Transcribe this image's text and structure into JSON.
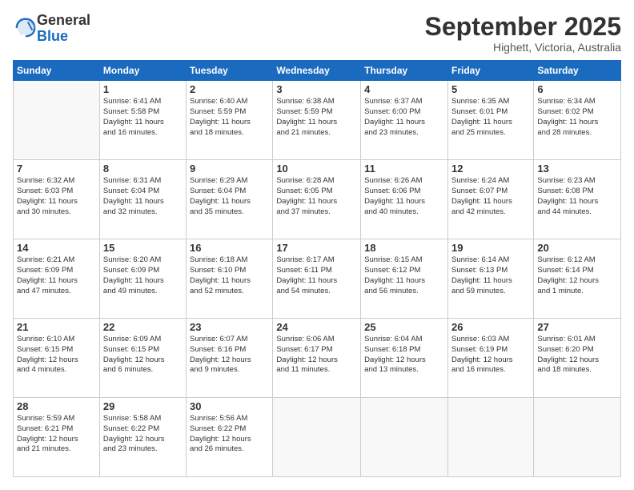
{
  "logo": {
    "general": "General",
    "blue": "Blue"
  },
  "header": {
    "month": "September 2025",
    "location": "Highett, Victoria, Australia"
  },
  "weekdays": [
    "Sunday",
    "Monday",
    "Tuesday",
    "Wednesday",
    "Thursday",
    "Friday",
    "Saturday"
  ],
  "weeks": [
    [
      {
        "day": "",
        "info": ""
      },
      {
        "day": "1",
        "info": "Sunrise: 6:41 AM\nSunset: 5:58 PM\nDaylight: 11 hours\nand 16 minutes."
      },
      {
        "day": "2",
        "info": "Sunrise: 6:40 AM\nSunset: 5:59 PM\nDaylight: 11 hours\nand 18 minutes."
      },
      {
        "day": "3",
        "info": "Sunrise: 6:38 AM\nSunset: 5:59 PM\nDaylight: 11 hours\nand 21 minutes."
      },
      {
        "day": "4",
        "info": "Sunrise: 6:37 AM\nSunset: 6:00 PM\nDaylight: 11 hours\nand 23 minutes."
      },
      {
        "day": "5",
        "info": "Sunrise: 6:35 AM\nSunset: 6:01 PM\nDaylight: 11 hours\nand 25 minutes."
      },
      {
        "day": "6",
        "info": "Sunrise: 6:34 AM\nSunset: 6:02 PM\nDaylight: 11 hours\nand 28 minutes."
      }
    ],
    [
      {
        "day": "7",
        "info": "Sunrise: 6:32 AM\nSunset: 6:03 PM\nDaylight: 11 hours\nand 30 minutes."
      },
      {
        "day": "8",
        "info": "Sunrise: 6:31 AM\nSunset: 6:04 PM\nDaylight: 11 hours\nand 32 minutes."
      },
      {
        "day": "9",
        "info": "Sunrise: 6:29 AM\nSunset: 6:04 PM\nDaylight: 11 hours\nand 35 minutes."
      },
      {
        "day": "10",
        "info": "Sunrise: 6:28 AM\nSunset: 6:05 PM\nDaylight: 11 hours\nand 37 minutes."
      },
      {
        "day": "11",
        "info": "Sunrise: 6:26 AM\nSunset: 6:06 PM\nDaylight: 11 hours\nand 40 minutes."
      },
      {
        "day": "12",
        "info": "Sunrise: 6:24 AM\nSunset: 6:07 PM\nDaylight: 11 hours\nand 42 minutes."
      },
      {
        "day": "13",
        "info": "Sunrise: 6:23 AM\nSunset: 6:08 PM\nDaylight: 11 hours\nand 44 minutes."
      }
    ],
    [
      {
        "day": "14",
        "info": "Sunrise: 6:21 AM\nSunset: 6:09 PM\nDaylight: 11 hours\nand 47 minutes."
      },
      {
        "day": "15",
        "info": "Sunrise: 6:20 AM\nSunset: 6:09 PM\nDaylight: 11 hours\nand 49 minutes."
      },
      {
        "day": "16",
        "info": "Sunrise: 6:18 AM\nSunset: 6:10 PM\nDaylight: 11 hours\nand 52 minutes."
      },
      {
        "day": "17",
        "info": "Sunrise: 6:17 AM\nSunset: 6:11 PM\nDaylight: 11 hours\nand 54 minutes."
      },
      {
        "day": "18",
        "info": "Sunrise: 6:15 AM\nSunset: 6:12 PM\nDaylight: 11 hours\nand 56 minutes."
      },
      {
        "day": "19",
        "info": "Sunrise: 6:14 AM\nSunset: 6:13 PM\nDaylight: 11 hours\nand 59 minutes."
      },
      {
        "day": "20",
        "info": "Sunrise: 6:12 AM\nSunset: 6:14 PM\nDaylight: 12 hours\nand 1 minute."
      }
    ],
    [
      {
        "day": "21",
        "info": "Sunrise: 6:10 AM\nSunset: 6:15 PM\nDaylight: 12 hours\nand 4 minutes."
      },
      {
        "day": "22",
        "info": "Sunrise: 6:09 AM\nSunset: 6:15 PM\nDaylight: 12 hours\nand 6 minutes."
      },
      {
        "day": "23",
        "info": "Sunrise: 6:07 AM\nSunset: 6:16 PM\nDaylight: 12 hours\nand 9 minutes."
      },
      {
        "day": "24",
        "info": "Sunrise: 6:06 AM\nSunset: 6:17 PM\nDaylight: 12 hours\nand 11 minutes."
      },
      {
        "day": "25",
        "info": "Sunrise: 6:04 AM\nSunset: 6:18 PM\nDaylight: 12 hours\nand 13 minutes."
      },
      {
        "day": "26",
        "info": "Sunrise: 6:03 AM\nSunset: 6:19 PM\nDaylight: 12 hours\nand 16 minutes."
      },
      {
        "day": "27",
        "info": "Sunrise: 6:01 AM\nSunset: 6:20 PM\nDaylight: 12 hours\nand 18 minutes."
      }
    ],
    [
      {
        "day": "28",
        "info": "Sunrise: 5:59 AM\nSunset: 6:21 PM\nDaylight: 12 hours\nand 21 minutes."
      },
      {
        "day": "29",
        "info": "Sunrise: 5:58 AM\nSunset: 6:22 PM\nDaylight: 12 hours\nand 23 minutes."
      },
      {
        "day": "30",
        "info": "Sunrise: 5:56 AM\nSunset: 6:22 PM\nDaylight: 12 hours\nand 26 minutes."
      },
      {
        "day": "",
        "info": ""
      },
      {
        "day": "",
        "info": ""
      },
      {
        "day": "",
        "info": ""
      },
      {
        "day": "",
        "info": ""
      }
    ]
  ]
}
